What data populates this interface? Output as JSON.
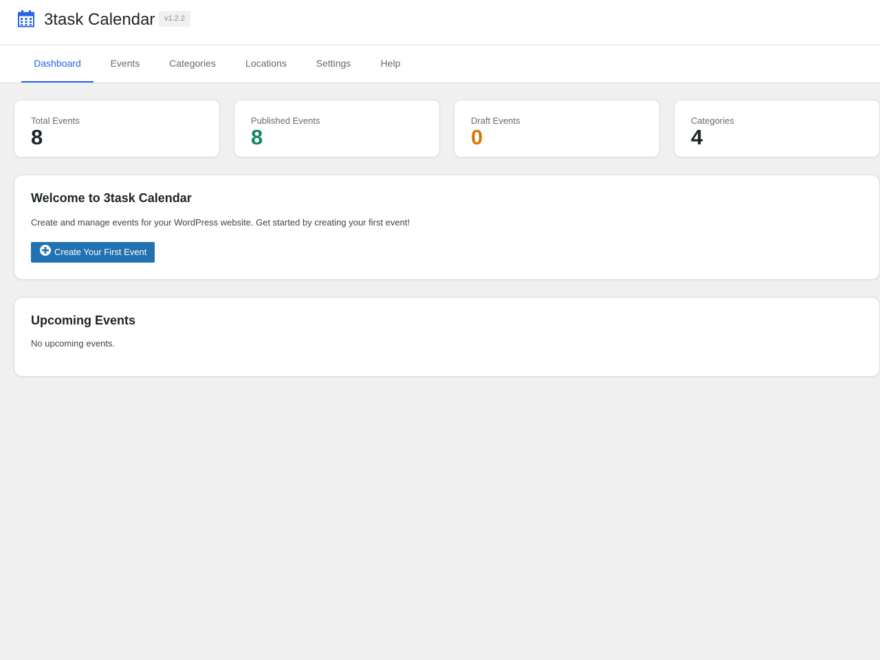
{
  "app": {
    "title": "3task Calendar",
    "version": "v1.2.2",
    "logo_icon": "calendar-icon",
    "accent_color": "#2563eb"
  },
  "tabs": [
    {
      "label": "Dashboard",
      "active": true
    },
    {
      "label": "Events",
      "active": false
    },
    {
      "label": "Categories",
      "active": false
    },
    {
      "label": "Locations",
      "active": false
    },
    {
      "label": "Settings",
      "active": false
    },
    {
      "label": "Help",
      "active": false
    }
  ],
  "stats": [
    {
      "label": "Total Events",
      "value": "8",
      "color": "#1d2327"
    },
    {
      "label": "Published Events",
      "value": "8",
      "color": "#0d8a5f"
    },
    {
      "label": "Draft Events",
      "value": "0",
      "color": "#d97706"
    },
    {
      "label": "Categories",
      "value": "4",
      "color": "#1d2327"
    }
  ],
  "welcome": {
    "title": "Welcome to 3task Calendar",
    "description": "Create and manage events for your WordPress website. Get started by creating your first event!",
    "button_label": "Create Your First Event",
    "button_icon": "plus-circle-icon",
    "button_color": "#2271b1"
  },
  "upcoming": {
    "title": "Upcoming Events",
    "empty_text": "No upcoming events."
  }
}
